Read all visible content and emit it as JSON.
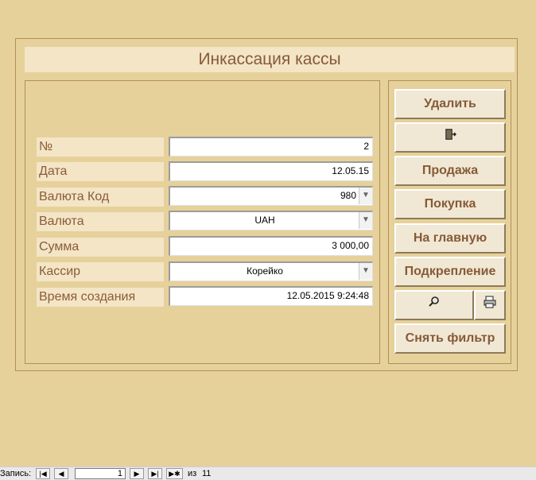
{
  "title": "Инкассация кассы",
  "fields": [
    {
      "label": "№",
      "value": "2"
    },
    {
      "label": "Дата",
      "value": "12.05.15"
    },
    {
      "label": "Валюта Код",
      "value": "980"
    },
    {
      "label": "Валюта",
      "value": "UAH"
    },
    {
      "label": "Сумма",
      "value": "3 000,00"
    },
    {
      "label": "Кассир",
      "value": "Корейко"
    },
    {
      "label": "Время создания",
      "value": "12.05.2015 9:24:48"
    }
  ],
  "buttons": {
    "delete": "Удалить",
    "exit_icon": "door-exit-icon",
    "sale": "Продажа",
    "purchase": "Покупка",
    "home": "На главную",
    "reinforcement": "Подкрепление",
    "search_icon": "magnifier-icon",
    "print_icon": "printer-icon",
    "remove_filter": "Снять фильтр"
  },
  "statusbar": {
    "label": "Запись:",
    "current": "1",
    "of": "из",
    "total": "11"
  },
  "colors": {
    "background": "#e6d19b",
    "label_bg": "#f3e5c6",
    "text_brown": "#865a37"
  }
}
